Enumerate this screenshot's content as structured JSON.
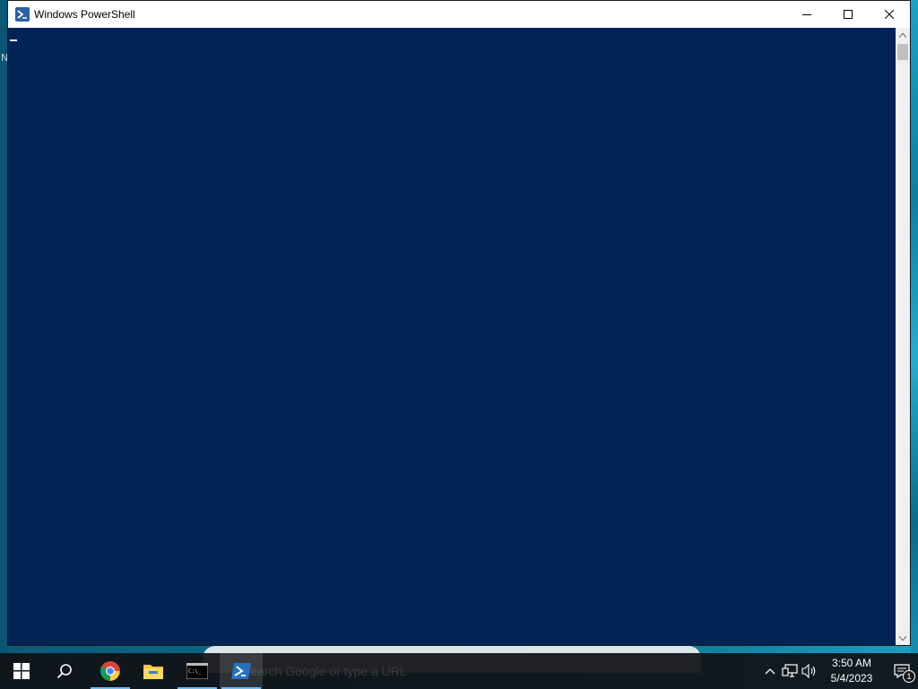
{
  "window": {
    "title": "Windows PowerShell",
    "console_background": "#012456"
  },
  "desktop": {
    "edge_letter": "N"
  },
  "ghost_search": {
    "placeholder_text": "Search Google or type a URL"
  },
  "taskbar": {
    "apps": [
      {
        "name": "start-button",
        "icon": "windows-logo-icon"
      },
      {
        "name": "search-button",
        "icon": "search-icon"
      },
      {
        "name": "chrome",
        "icon": "chrome-icon"
      },
      {
        "name": "file-explorer",
        "icon": "folder-icon"
      },
      {
        "name": "command-prompt",
        "icon": "cmd-icon"
      },
      {
        "name": "powershell",
        "icon": "powershell-icon"
      }
    ],
    "clock": {
      "time": "3:50 AM",
      "date": "5/4/2023"
    },
    "notification_count": "1"
  }
}
